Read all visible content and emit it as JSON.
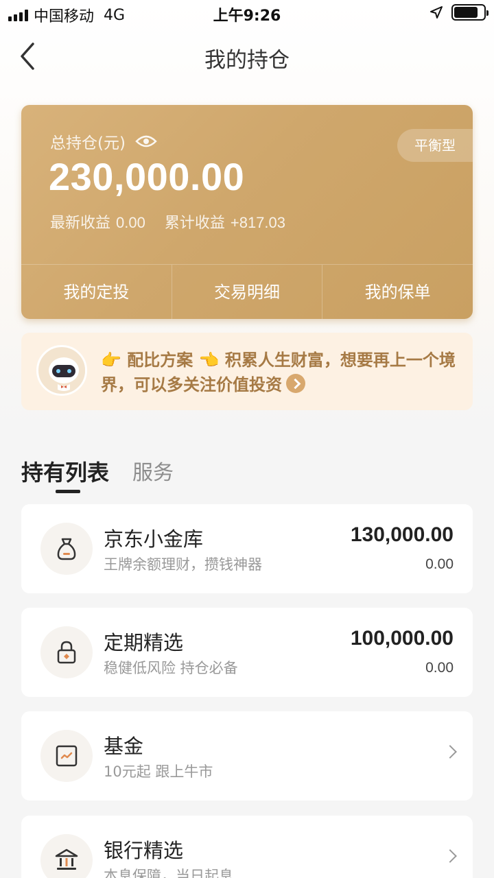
{
  "status_bar": {
    "carrier": "中国移动",
    "network": "4G",
    "time": "上午9:26"
  },
  "nav": {
    "title": "我的持仓",
    "back_icon": "chevron-left-icon"
  },
  "holdings_card": {
    "label": "总持仓(元)",
    "eye_icon": "eye-icon",
    "amount": "230,000.00",
    "risk_type": "平衡型",
    "latest_income_label": "最新收益",
    "latest_income_value": "0.00",
    "total_income_label": "累计收益",
    "total_income_value": "+817.03",
    "actions": [
      {
        "label": "我的定投"
      },
      {
        "label": "交易明细"
      },
      {
        "label": "我的保单"
      }
    ],
    "colors": {
      "card_start": "#d8b27a",
      "card_end": "#c9a062"
    }
  },
  "tip": {
    "text": "👉 配比方案 👈 积累人生财富，想要再上一个境界，可以多关注价值投资",
    "avatar_icon": "robot-avatar-icon",
    "arrow_icon": "circle-arrow-right-icon",
    "color": "#a67a45"
  },
  "tabs": [
    {
      "label": "持有列表",
      "active": true
    },
    {
      "label": "服务",
      "active": false
    }
  ],
  "holdings": [
    {
      "name": "京东小金库",
      "desc": "王牌余额理财，攒钱神器",
      "amount": "130,000.00",
      "income": "0.00",
      "icon": "money-bag-icon"
    },
    {
      "name": "定期精选",
      "desc": "稳健低风险 持仓必备",
      "amount": "100,000.00",
      "income": "0.00",
      "icon": "lock-icon"
    },
    {
      "name": "基金",
      "desc": "10元起 跟上牛市",
      "icon": "chart-icon"
    },
    {
      "name": "银行精选",
      "desc": "本息保障，当日起息",
      "icon": "bank-icon"
    }
  ]
}
